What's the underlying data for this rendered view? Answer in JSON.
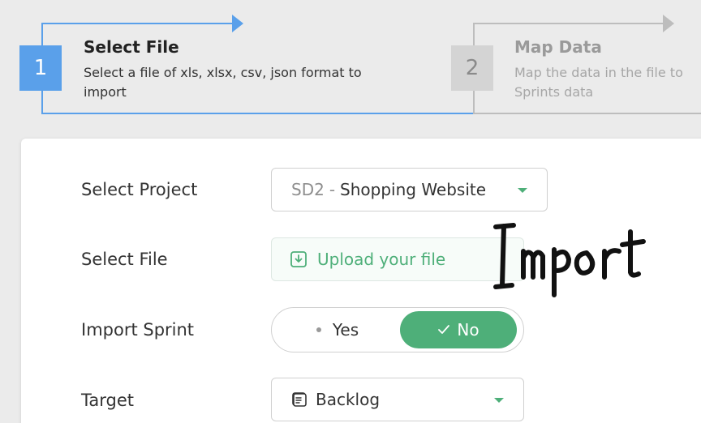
{
  "stepper": {
    "steps": [
      {
        "number": "1",
        "title": "Select File",
        "description": "Select a file of xls, xlsx, csv, json format to import",
        "state": "active"
      },
      {
        "number": "2",
        "title": "Map Data",
        "description": "Map the data in the file to Sprints data",
        "state": "inactive"
      }
    ],
    "active_color": "#5aa0ea",
    "inactive_color": "#bdbdbd"
  },
  "form": {
    "project": {
      "label": "Select Project",
      "code": "SD2",
      "separator": "-",
      "name": "Shopping Website"
    },
    "file": {
      "label": "Select File",
      "upload_text": "Upload your file",
      "icon": "upload-icon"
    },
    "import_sprint": {
      "label": "Import Sprint",
      "yes_label": "Yes",
      "no_label": "No",
      "selected": "No"
    },
    "target": {
      "label": "Target",
      "value": "Backlog",
      "icon": "backlog-icon"
    }
  },
  "overlay": {
    "text": "Import"
  },
  "colors": {
    "accent_green": "#4eaf79",
    "accent_blue": "#5aa0ea"
  }
}
